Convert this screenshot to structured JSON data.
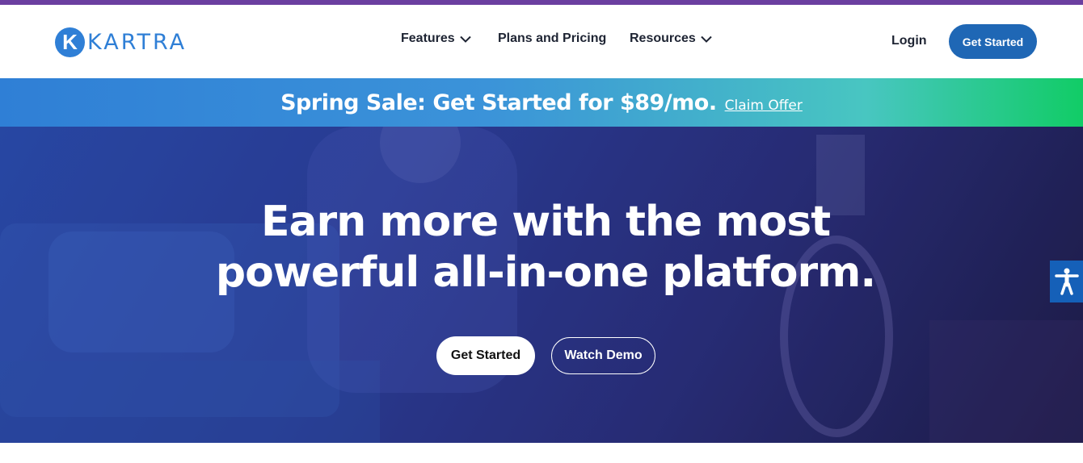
{
  "brand": {
    "name": "KARTRA",
    "mark_letter": "K",
    "color": "#2f7fd6"
  },
  "nav": {
    "items": [
      {
        "label": "Features",
        "has_dropdown": true
      },
      {
        "label": "Plans and Pricing",
        "has_dropdown": false
      },
      {
        "label": "Resources",
        "has_dropdown": true
      }
    ],
    "login_label": "Login",
    "cta_label": "Get Started"
  },
  "promo": {
    "text": "Spring Sale: Get Started for $89/mo.",
    "link_label": "Claim Offer"
  },
  "hero": {
    "title_line1": "Earn more with the most",
    "title_line2": "powerful all-in-one platform.",
    "primary_cta": "Get Started",
    "secondary_cta": "Watch Demo"
  },
  "accessibility": {
    "icon": "accessibility-person-icon"
  },
  "colors": {
    "top_strip": "#6b3fa0",
    "cta_blue": "#1f67b5",
    "promo_green": "#11cc66"
  }
}
